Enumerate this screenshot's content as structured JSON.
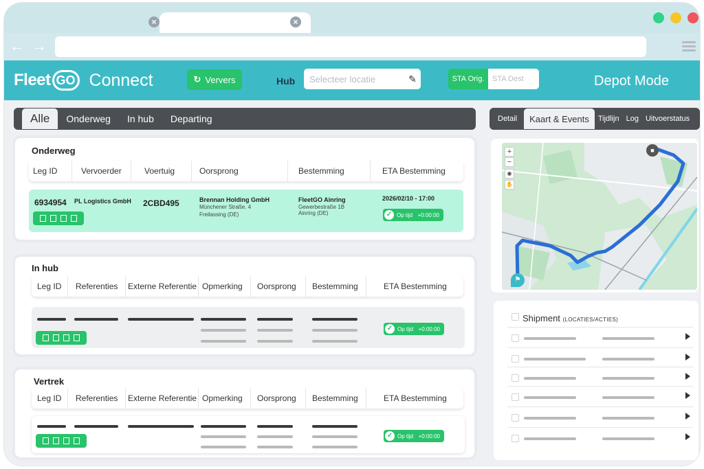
{
  "colors": {
    "brand_teal": "#3cbbc7",
    "accent_green": "#28c36a",
    "row_highlight": "#b8f5df",
    "dark_tab": "#4b4e52"
  },
  "browser": {
    "back_icon": "arrow-left-icon",
    "forward_icon": "arrow-right-icon",
    "close_icon": "close-icon",
    "menu_icon": "hamburger-icon"
  },
  "header": {
    "logo_fleet": "Fleet",
    "logo_go": "GO",
    "logo_connect": "Connect",
    "refresh_label": "Ververs",
    "hub_label": "Hub",
    "hub_placeholder": "Selecteer locatie",
    "sta_orig": "STA Orig.",
    "sta_dest": "STA Dest",
    "mode": "Depot Mode"
  },
  "filter_tabs": [
    "Alle",
    "Onderweg",
    "In hub",
    "Departing"
  ],
  "onderweg": {
    "title": "Onderweg",
    "columns": [
      "Leg ID",
      "Vervoerder",
      "Voertuig",
      "Oorsprong",
      "Bestemming",
      "ETA Bestemming"
    ],
    "row": {
      "leg_id": "6934954",
      "carrier": "PL Logistics GmbH",
      "vehicle": "2CBD495",
      "origin_name": "Brennan Holding GmbH",
      "origin_street": "Münchener Straße. 4",
      "origin_city": "Freilassing (DE)",
      "dest_name": "FleetGO Ainring",
      "dest_street": "Gewerbestraße 1B",
      "dest_city": "Ainring (DE)",
      "eta": "2026/02/10 - 17:00",
      "status": "Op tijd",
      "delay": "+0:00:00"
    }
  },
  "in_hub": {
    "title": "In hub",
    "columns": [
      "Leg ID",
      "Referenties",
      "Externe Referentie",
      "Opmerking",
      "Oorsprong",
      "Bestemming",
      "ETA Bestemming"
    ],
    "status": "Op tijd",
    "delay": "+0:00:00"
  },
  "vertrek": {
    "title": "Vertrek",
    "columns": [
      "Leg ID",
      "Referenties",
      "Externe Referentie",
      "Opmerking",
      "Oorsprong",
      "Bestemming",
      "ETA Bestemming"
    ],
    "status": "Op tijd",
    "delay": "+0:00:00"
  },
  "right_tabs": [
    "Detail",
    "Kaart & Events",
    "Tijdlijn",
    "Log",
    "Uitvoerstatus"
  ],
  "map": {
    "zoom_in": "+",
    "zoom_out": "−",
    "truck_icon": "truck-icon",
    "flag_icon": "flag-icon",
    "route_color": "#2a6fd6"
  },
  "shipment": {
    "title": "Shipment",
    "subtitle": "(LOCATIES/ACTIES)"
  }
}
